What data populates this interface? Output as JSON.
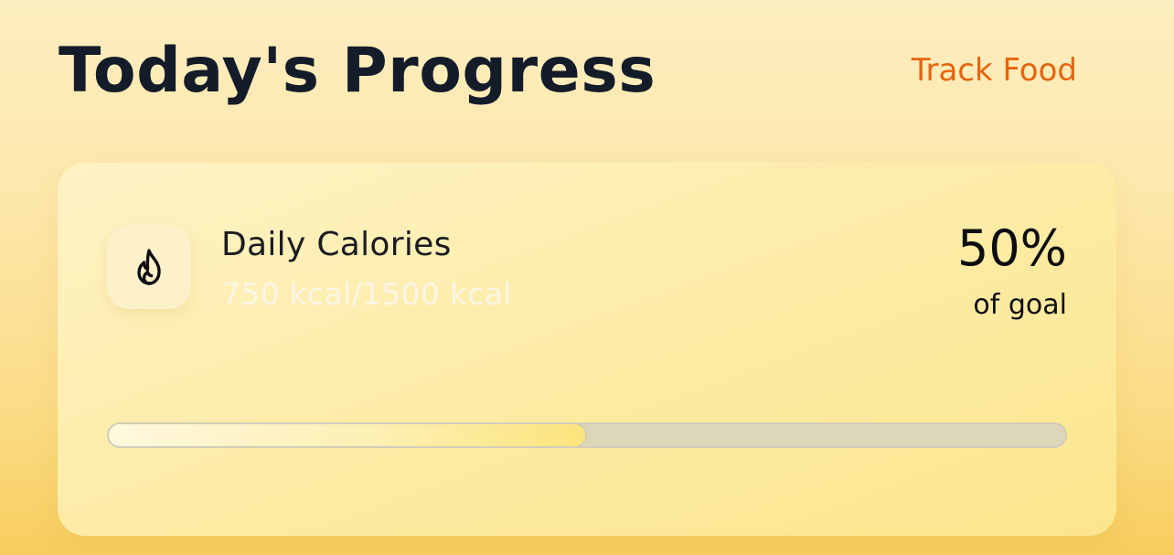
{
  "header": {
    "title": "Today's Progress",
    "track_link": "Track Food"
  },
  "card": {
    "icon": "flame-icon",
    "metric_title": "Daily Calories",
    "metric_value": "750 kcal/1500 kcal",
    "percent_label": "50%",
    "percent_caption": "of goal",
    "progress_fraction": 0.5
  },
  "colors": {
    "accent": "#e8630f",
    "title": "#141b29",
    "progress_fill": "#fce47c",
    "progress_track": "#ddd6b9"
  }
}
